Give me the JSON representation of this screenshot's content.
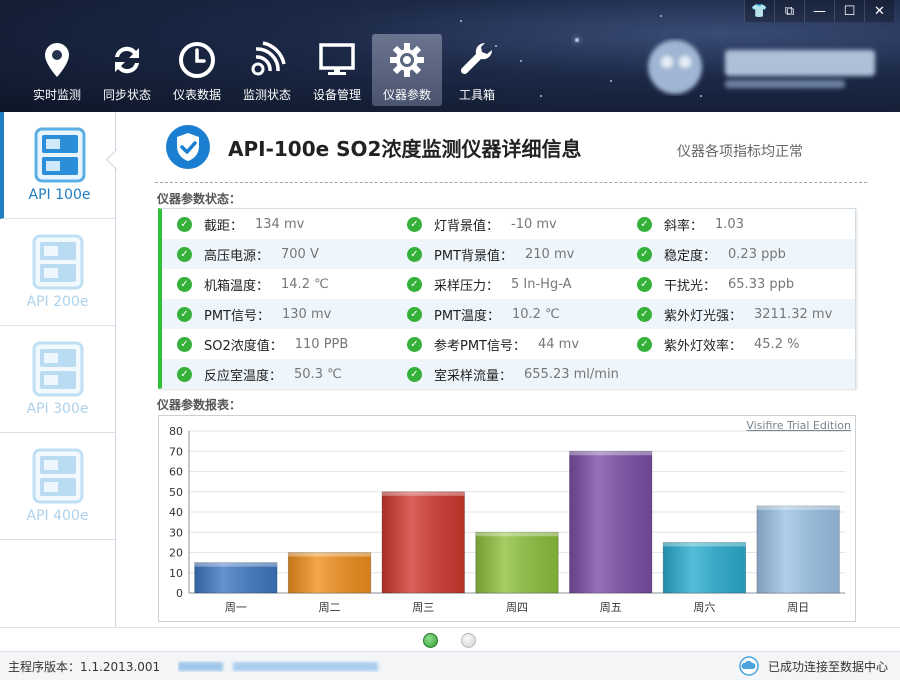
{
  "nav": [
    {
      "label": "实时监测",
      "icon": "location-pin-icon"
    },
    {
      "label": "同步状态",
      "icon": "sync-icon"
    },
    {
      "label": "仪表数据",
      "icon": "clock-icon"
    },
    {
      "label": "监测状态",
      "icon": "signal-icon"
    },
    {
      "label": "设备管理",
      "icon": "monitor-icon"
    },
    {
      "label": "仪器参数",
      "icon": "gear-icon",
      "active": true
    },
    {
      "label": "工具箱",
      "icon": "wrench-icon"
    }
  ],
  "window_controls": [
    "shirt-icon",
    "restore-icon",
    "minimize-icon",
    "maximize-icon",
    "close-icon"
  ],
  "sidebar": [
    {
      "label": "API 100e",
      "active": true
    },
    {
      "label": "API 200e"
    },
    {
      "label": "API 300e"
    },
    {
      "label": "API 400e"
    }
  ],
  "header": {
    "title": "API-100e SO2浓度监测仪器详细信息",
    "status": "仪器各项指标均正常"
  },
  "params_label": "仪器参数状态：",
  "params": [
    [
      {
        "name": "截距：",
        "value": "134 mv"
      },
      {
        "name": "灯背景值：",
        "value": "-10 mv"
      },
      {
        "name": "斜率：",
        "value": "1.03"
      }
    ],
    [
      {
        "name": "高压电源：",
        "value": "700 V"
      },
      {
        "name": "PMT背景值：",
        "value": "210 mv"
      },
      {
        "name": "稳定度：",
        "value": "0.23 ppb"
      }
    ],
    [
      {
        "name": "机箱温度：",
        "value": "14.2 ℃"
      },
      {
        "name": "采样压力：",
        "value": "5 In-Hg-A"
      },
      {
        "name": "干扰光：",
        "value": "65.33 ppb"
      }
    ],
    [
      {
        "name": "PMT信号：",
        "value": "130 mv"
      },
      {
        "name": "PMT温度：",
        "value": "10.2 ℃"
      },
      {
        "name": "紫外灯光强：",
        "value": "3211.32 mv"
      }
    ],
    [
      {
        "name": "SO2浓度值：",
        "value": "110 PPB"
      },
      {
        "name": "参考PMT信号：",
        "value": "44 mv"
      },
      {
        "name": "紫外灯效率：",
        "value": "45.2 %"
      }
    ],
    [
      {
        "name": "反应室温度：",
        "value": "50.3 ℃"
      },
      {
        "name": "室采样流量：",
        "value": "655.23 ml/min"
      }
    ]
  ],
  "chart_label": "仪器参数报表：",
  "chart_data": {
    "type": "bar",
    "categories": [
      "周一",
      "周二",
      "周三",
      "周四",
      "周五",
      "周六",
      "周日"
    ],
    "values": [
      15,
      20,
      50,
      30,
      70,
      25,
      43
    ],
    "colors": [
      "#3f78c4",
      "#f0901e",
      "#d0392f",
      "#8fc13e",
      "#7b4fa7",
      "#2aaed0",
      "#9cc3e6"
    ],
    "ylim": [
      0,
      80
    ],
    "yticks": [
      0,
      10,
      20,
      30,
      40,
      50,
      60,
      70,
      80
    ],
    "grid": true,
    "watermark": "Visifire Trial Edition"
  },
  "pager_active": 0,
  "footer": {
    "version": "主程序版本：1.1.2013.001",
    "connection": "已成功连接至数据中心"
  }
}
